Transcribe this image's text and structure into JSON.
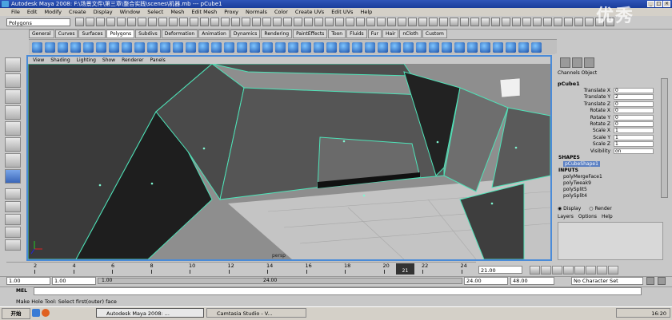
{
  "window": {
    "title": "Autodesk Maya 2008: F:\\场景文件\\第三章\\整合实践\\scenes\\机器.mb  ---  pCube1"
  },
  "menu": [
    "File",
    "Edit",
    "Modify",
    "Create",
    "Display",
    "Window",
    "Select",
    "Mesh",
    "Edit Mesh",
    "Proxy",
    "Normals",
    "Color",
    "Create UVs",
    "Edit UVs",
    "Help"
  ],
  "status_line": {
    "mode": "Polygons"
  },
  "shelf_tabs": [
    "General",
    "Curves",
    "Surfaces",
    "Polygons",
    "Subdivs",
    "Deformation",
    "Animation",
    "Dynamics",
    "Rendering",
    "PaintEffects",
    "Toon",
    "Fluids",
    "Fur",
    "Hair",
    "nCloth",
    "Custom"
  ],
  "shelf_active_tab": "Polygons",
  "panel_menu": [
    "View",
    "Shading",
    "Lighting",
    "Show",
    "Renderer",
    "Panels"
  ],
  "viewport": {
    "camera": "persp"
  },
  "channel_box": {
    "header": "Channels  Object",
    "object": "pCube1",
    "attributes": [
      {
        "name": "Translate X",
        "value": "0"
      },
      {
        "name": "Translate Y",
        "value": "2"
      },
      {
        "name": "Translate Z",
        "value": "0"
      },
      {
        "name": "Rotate X",
        "value": "0"
      },
      {
        "name": "Rotate Y",
        "value": "0"
      },
      {
        "name": "Rotate Z",
        "value": "0"
      },
      {
        "name": "Scale X",
        "value": "1"
      },
      {
        "name": "Scale Y",
        "value": "1"
      },
      {
        "name": "Scale Z",
        "value": "1"
      },
      {
        "name": "Visibility",
        "value": "on"
      }
    ],
    "shapes_label": "SHAPES",
    "shape_node": "pCubeShape1",
    "inputs_label": "INPUTS",
    "input_nodes": [
      "polyMergeFace1",
      "polyTweak9",
      "polySplit5",
      "polySplit4"
    ]
  },
  "layer_editor": {
    "display_label": "Display",
    "render_label": "Render",
    "menu": [
      "Layers",
      "Options",
      "Help"
    ]
  },
  "timeline": {
    "ticks": [
      "2",
      "4",
      "6",
      "8",
      "10",
      "12",
      "14",
      "16",
      "18",
      "20",
      "22",
      "24"
    ],
    "current_frame_marker": "21",
    "current_frame": "21.00"
  },
  "range": {
    "start": "1.00",
    "playback_start": "1.00",
    "slider_start": "1.00",
    "slider_end": "24.00",
    "playback_end": "24.00",
    "end": "48.00",
    "character_set": "No Character Set"
  },
  "command_line": {
    "label": "MEL"
  },
  "help_line": {
    "text": "Make Hole Tool: Select first(outer) face"
  },
  "taskbar": {
    "start": "开始",
    "tasks": [
      "Autodesk Maya 2008: ...",
      "Camtasia Studio - V..."
    ],
    "clock": "16:20"
  },
  "watermark": "优秀",
  "colors": {
    "title_bar": "#1a3d9a",
    "wireframe_highlight": "#4fe3b8",
    "active_viewport_border": "#4a8bd8"
  }
}
